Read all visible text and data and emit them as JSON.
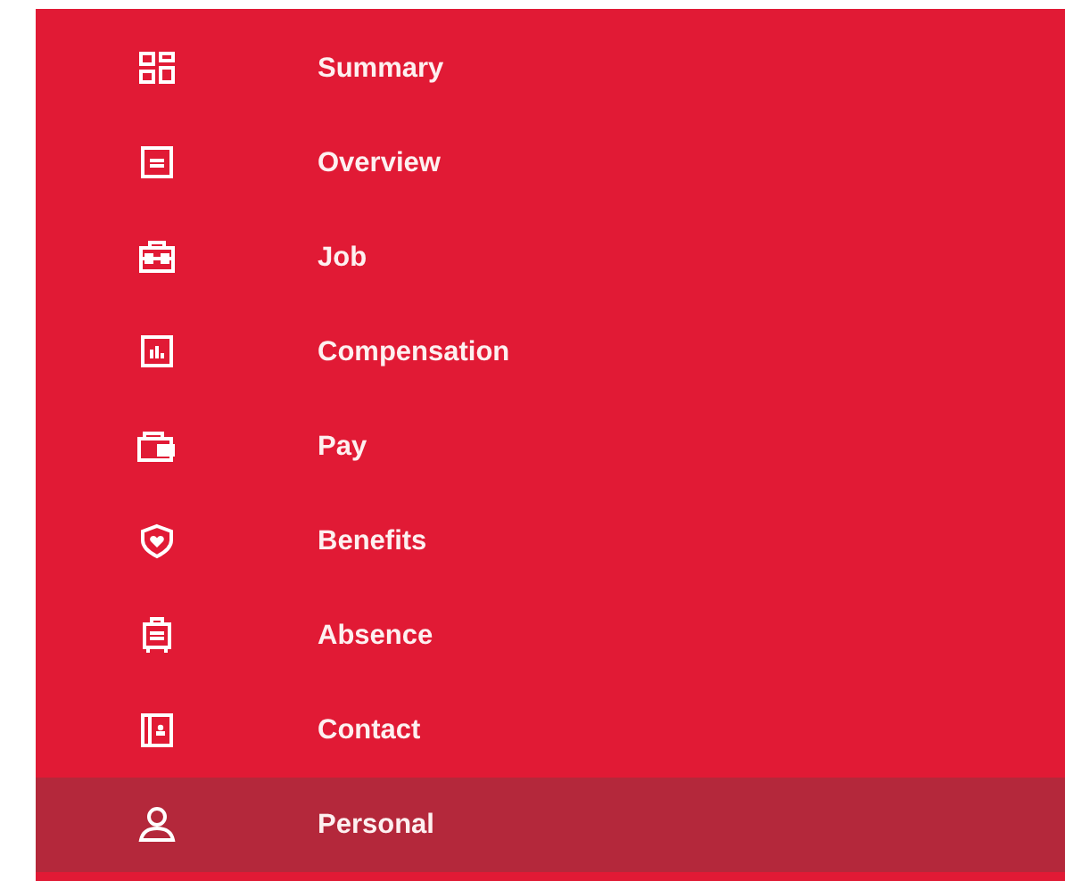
{
  "nav": {
    "items": [
      {
        "label": "Summary",
        "selected": false
      },
      {
        "label": "Overview",
        "selected": false
      },
      {
        "label": "Job",
        "selected": false
      },
      {
        "label": "Compensation",
        "selected": false
      },
      {
        "label": "Pay",
        "selected": false
      },
      {
        "label": "Benefits",
        "selected": false
      },
      {
        "label": "Absence",
        "selected": false
      },
      {
        "label": "Contact",
        "selected": false
      },
      {
        "label": "Personal",
        "selected": true
      }
    ]
  }
}
